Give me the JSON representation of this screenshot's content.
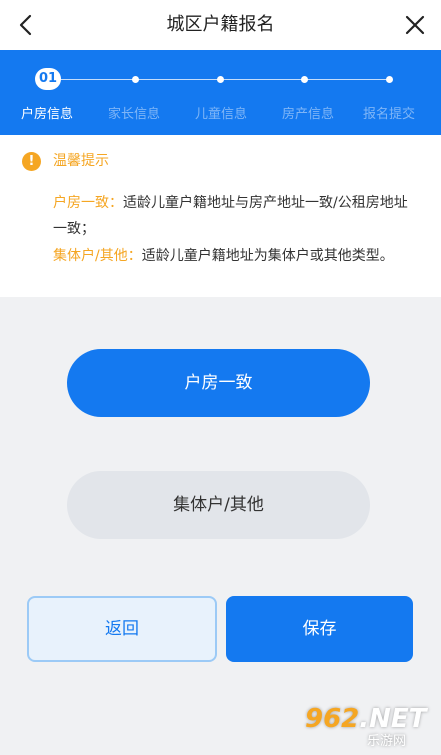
{
  "header": {
    "title": "城区户籍报名",
    "back_icon": "chevron-left-icon",
    "close_icon": "close-icon"
  },
  "stepper": {
    "current_step_number": "01",
    "steps": [
      {
        "label": "户房信息",
        "active": true
      },
      {
        "label": "家长信息",
        "active": false
      },
      {
        "label": "儿童信息",
        "active": false
      },
      {
        "label": "房产信息",
        "active": false
      },
      {
        "label": "报名提交",
        "active": false
      }
    ]
  },
  "tips": {
    "title": "温馨提示",
    "icon": "warning-icon",
    "items": [
      {
        "key": "户房一致：",
        "text": "适龄儿童户籍地址与房产地址一致/公租房地址一致；"
      },
      {
        "key": "集体户/其他：",
        "text": "适龄儿童户籍地址为集体户或其他类型。"
      }
    ]
  },
  "options": {
    "option1": "户房一致",
    "option2": "集体户/其他"
  },
  "footer": {
    "back_label": "返回",
    "save_label": "保存"
  },
  "watermark": {
    "num": "962",
    "suffix": ".NET",
    "sub": "乐游网"
  },
  "colors": {
    "primary": "#1479f0",
    "warning": "#f5a623",
    "background": "#f0f1f3"
  }
}
